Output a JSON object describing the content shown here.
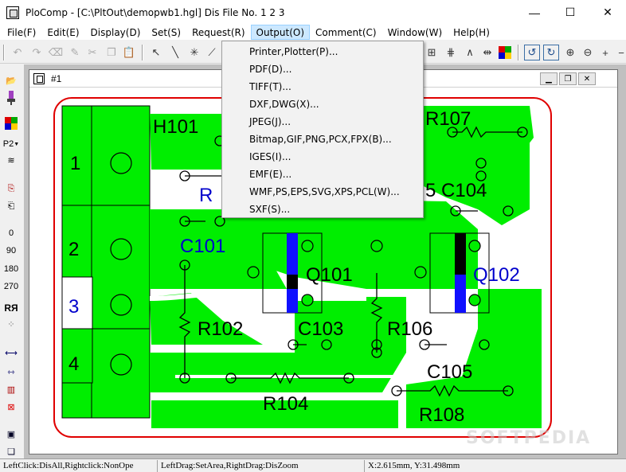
{
  "window": {
    "title": "PloComp - [C:\\PltOut\\demopwb1.hgl] Dis File No. 1 2 3",
    "minimize": "—",
    "maximize": "☐",
    "close": "✕"
  },
  "menu": [
    "File(F)",
    "Edit(E)",
    "Display(D)",
    "Set(S)",
    "Request(R)",
    "Output(O)",
    "Comment(C)",
    "Window(W)",
    "Help(H)"
  ],
  "output_menu": [
    "Printer,Plotter(P)...",
    "PDF(D)...",
    "TIFF(T)...",
    "DXF,DWG(X)...",
    "JPEG(J)...",
    "Bitmap,GIF,PNG,PCX,FPX(B)...",
    "IGES(I)...",
    "EMF(E)...",
    "WMF,PS,EPS,SVG,XPS,PCL(W)...",
    "SXF(S)..."
  ],
  "left_toolbar": {
    "layer_label": "P2",
    "angles": [
      "0",
      "90",
      "180",
      "270"
    ],
    "mirror_label": "RЯ"
  },
  "child_window": {
    "title": "#1"
  },
  "pcb_labels": {
    "h101": "H101",
    "r107": "R107",
    "c104": "5 C104",
    "r_partial": "R",
    "c101": "C101",
    "q101": "Q101",
    "q102": "Q102",
    "r102": "R102",
    "c103": "C103",
    "r106": "R106",
    "c105": "C105",
    "r104": "R104",
    "r108": "R108",
    "pin1": "1",
    "pin2": "2",
    "pin3": "3",
    "pin4": "4"
  },
  "status": {
    "left": "LeftClick:DisAll,Rightclick:NonOpe",
    "middle": "LeftDrag:SetArea,RightDrag:DisZoom",
    "coords": "X:2.615mm, Y:31.498mm"
  },
  "watermark": "SOFTPEDIA",
  "colors": {
    "copper": "#00ee00",
    "board_outline": "#e00000",
    "silkscreen_text": "#0000cc",
    "menu_highlight": "#cce8ff"
  }
}
